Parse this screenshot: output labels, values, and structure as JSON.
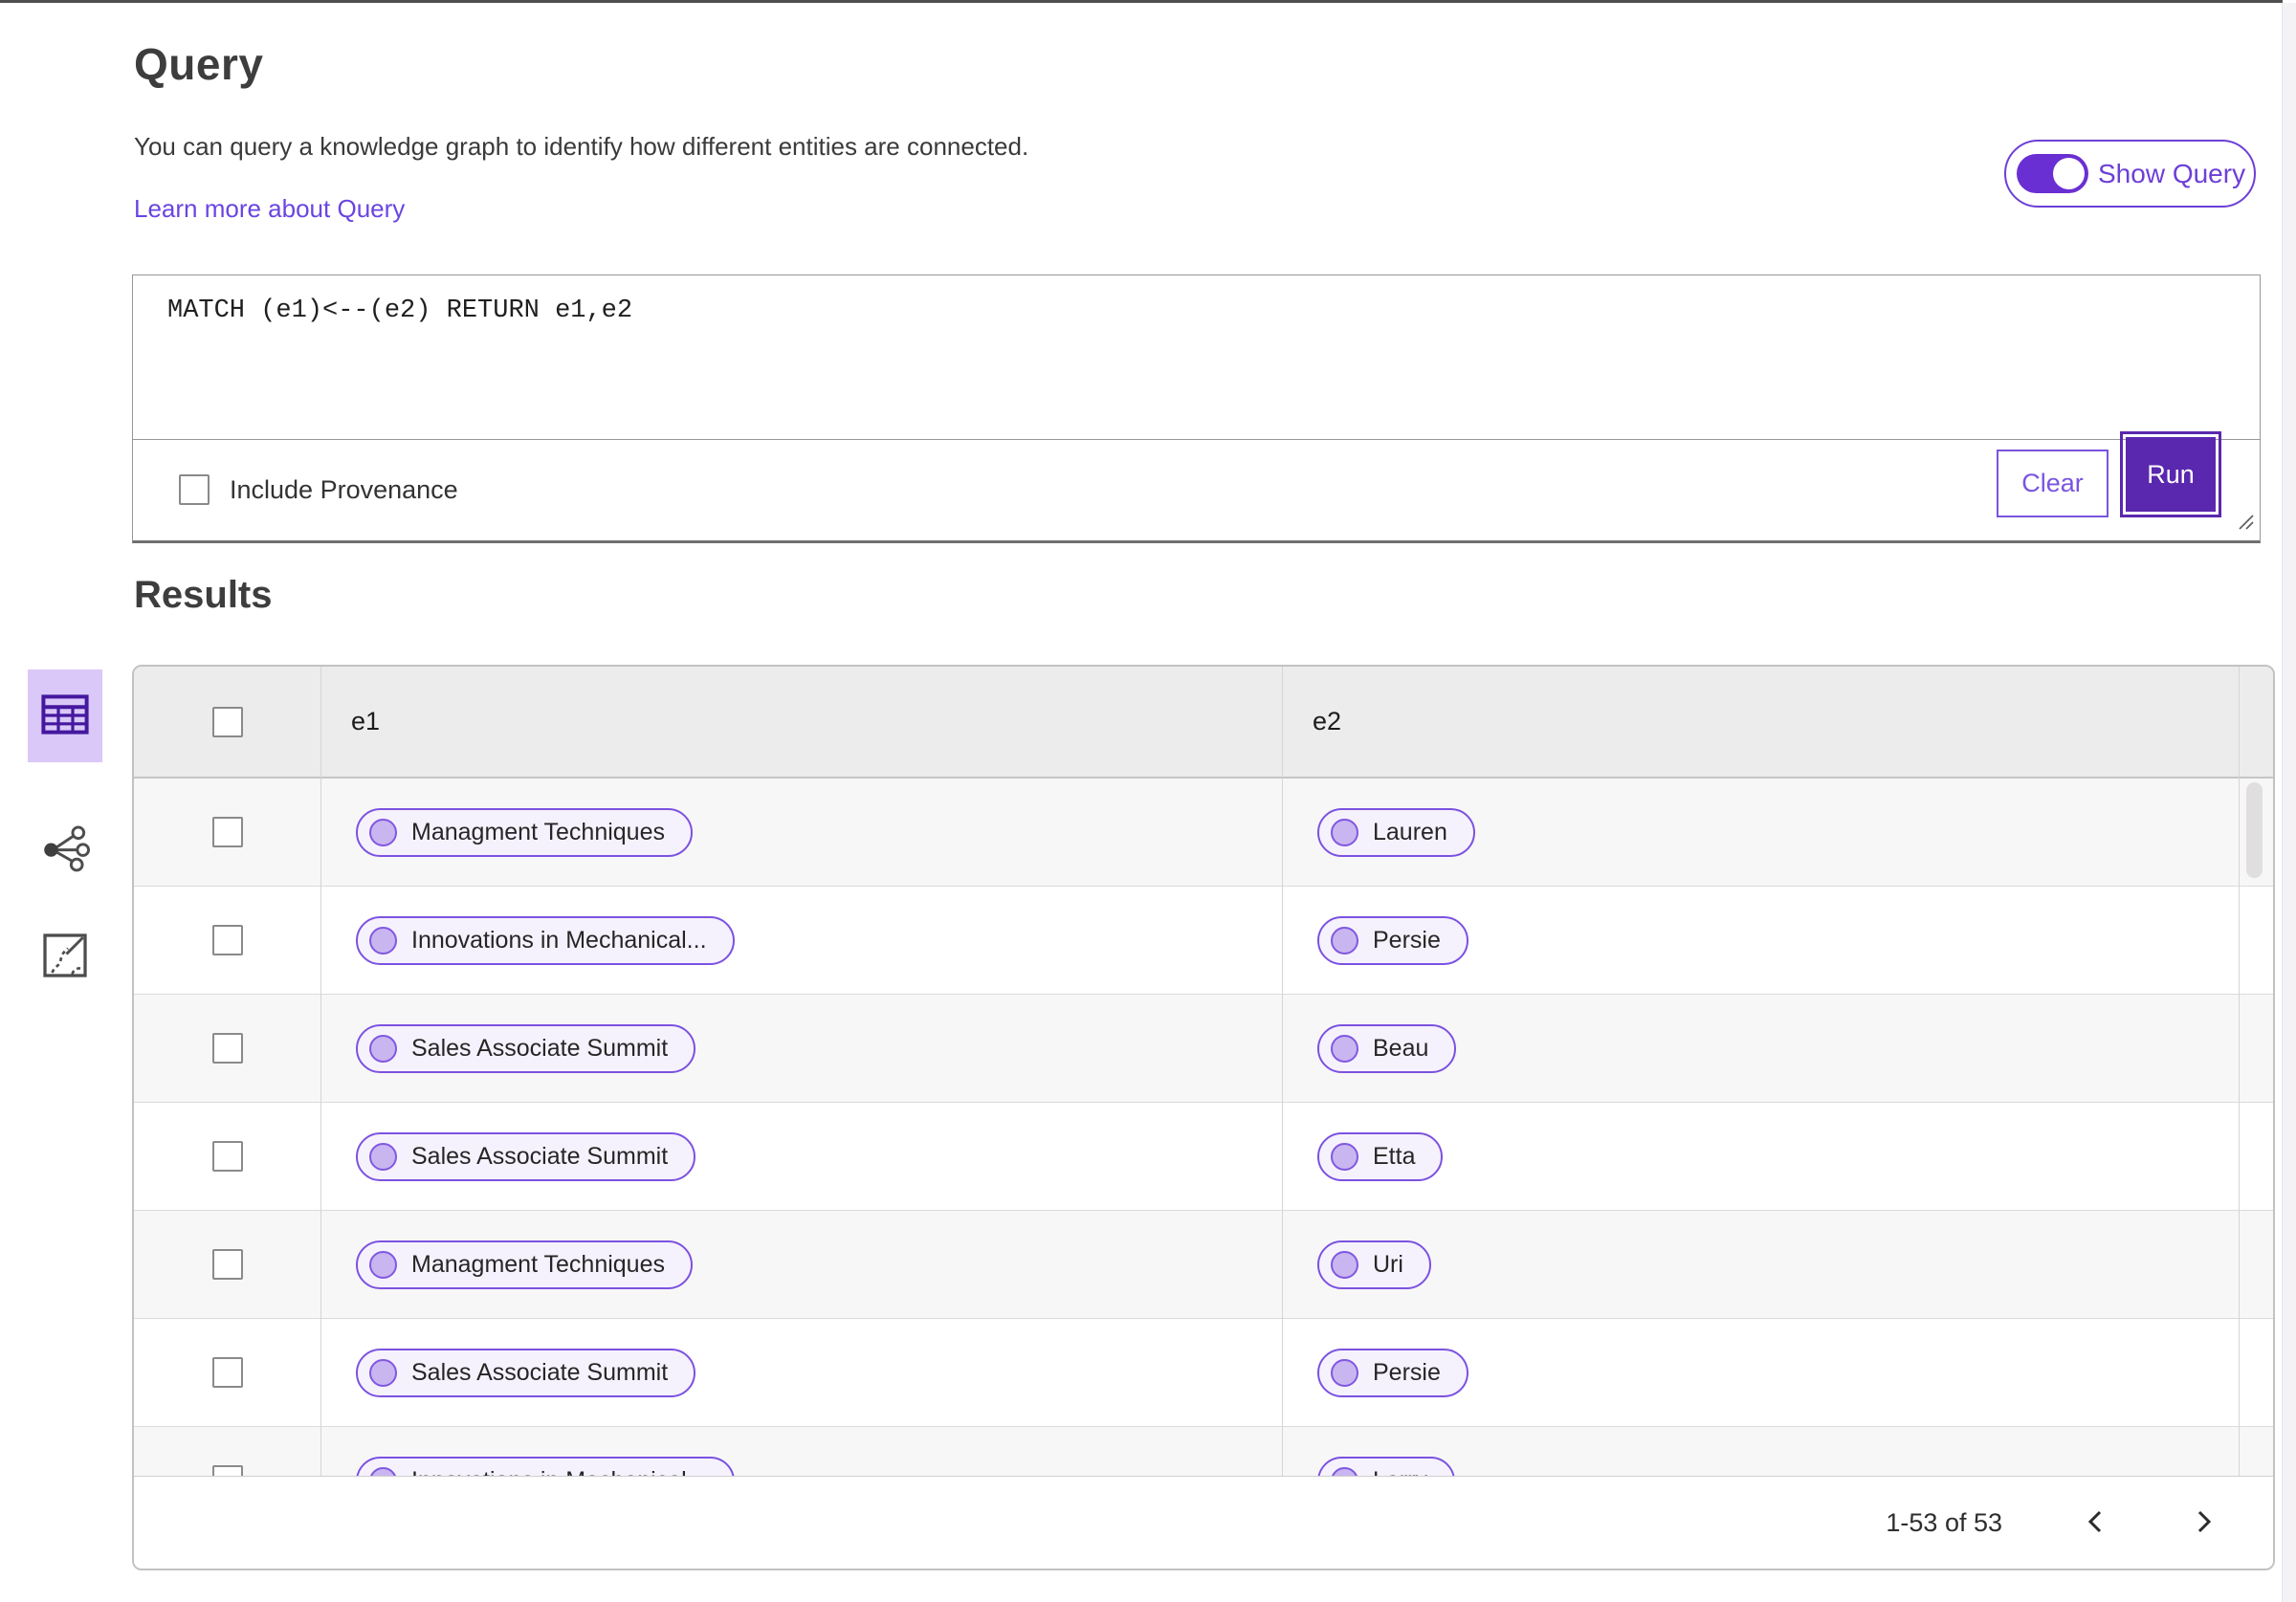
{
  "header": {
    "title": "Query",
    "description": "You can query a knowledge graph to identify how different entities are connected.",
    "learn_more_link": "Learn more about Query",
    "show_query_toggle": {
      "label": "Show Query",
      "state": "on"
    }
  },
  "query_panel": {
    "query_text": "MATCH (e1)<--(e2) RETURN e1,e2",
    "include_provenance": {
      "label": "Include Provenance",
      "checked": false
    },
    "clear_button": "Clear",
    "run_button": "Run"
  },
  "results": {
    "title": "Results",
    "view_switcher": [
      {
        "name": "table-view",
        "selected": true
      },
      {
        "name": "graph-view",
        "selected": false
      },
      {
        "name": "minimap-view",
        "selected": false
      }
    ],
    "table": {
      "columns": [
        "e1",
        "e2"
      ],
      "header_checkbox_checked": false,
      "rows": [
        {
          "e1": "Managment Techniques",
          "e2": "Lauren"
        },
        {
          "e1": "Innovations in Mechanical...",
          "e2": "Persie"
        },
        {
          "e1": "Sales Associate Summit",
          "e2": "Beau"
        },
        {
          "e1": "Sales Associate Summit",
          "e2": "Etta"
        },
        {
          "e1": "Managment Techniques",
          "e2": "Uri"
        },
        {
          "e1": "Sales Associate Summit",
          "e2": "Persie"
        },
        {
          "e1": "Innovations in Mechanical...",
          "e2": "Larry"
        }
      ]
    },
    "pagination": {
      "range_label": "1-53 of 53"
    }
  },
  "colors": {
    "accent": "#5a28ae",
    "toggle_purple": "#6d3fd6",
    "pill_border": "#7c52e0",
    "pill_bg": "#f6f2fd",
    "selected_tile_bg": "#d9c8f8",
    "link": "#6a45e0",
    "header_row_bg": "#ececec",
    "stripe_row_bg": "#f7f7f7"
  }
}
